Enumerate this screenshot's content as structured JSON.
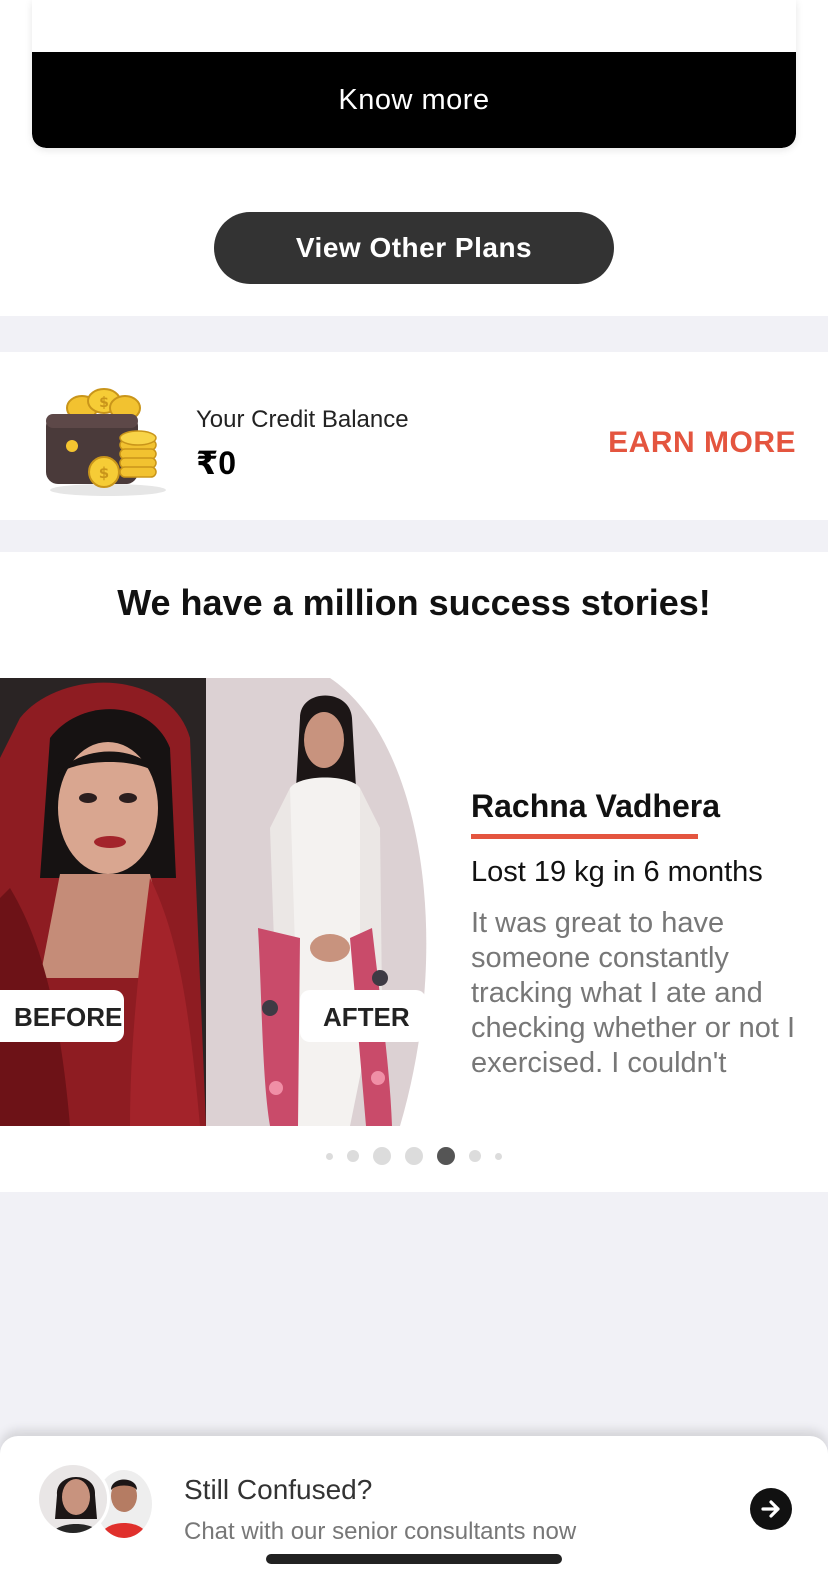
{
  "plan_card": {
    "know_more_label": "Know more"
  },
  "plans": {
    "view_other_plans_label": "View Other Plans"
  },
  "credit": {
    "label": "Your Credit Balance",
    "amount": "₹0",
    "earn_more_label": "EARN MORE",
    "icon": "wallet-coins-icon"
  },
  "stories": {
    "title": "We have a million success stories!",
    "current": {
      "before_label": "BEFORE",
      "after_label": "AFTER",
      "name": "Rachna Vadhera",
      "result": "Lost 19 kg in 6 months",
      "quote": "It was great to have someone constantly tracking what I ate and checking whether or not I exercised. I couldn't"
    },
    "pagination": {
      "total": 7,
      "active_index": 4
    }
  },
  "chat": {
    "title": "Still Confused?",
    "subtitle": "Chat with our senior consultants now",
    "arrow_icon": "arrow-right-icon"
  },
  "colors": {
    "accent": "#e4553f",
    "dark_button": "#333333",
    "black_button": "#000000",
    "page_background": "#f1f1f6"
  }
}
